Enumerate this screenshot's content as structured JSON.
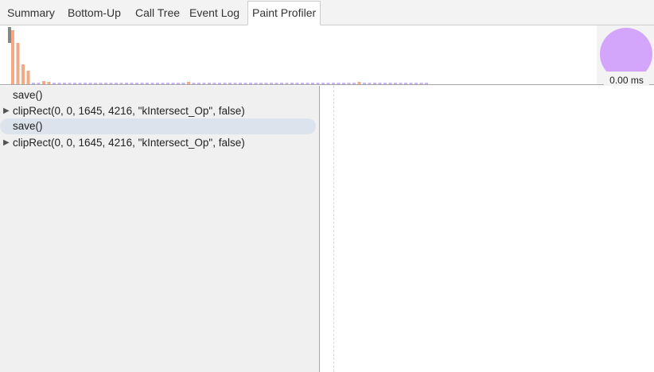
{
  "tabs": [
    {
      "label": "Summary"
    },
    {
      "label": "Bottom-Up"
    },
    {
      "label": "Call Tree"
    },
    {
      "label": "Event Log"
    },
    {
      "label": "Paint Profiler"
    }
  ],
  "selected_tab": "Paint Profiler",
  "overview": {
    "total_time": "0.00 ms",
    "bar_heights": [
      68,
      52,
      25,
      17,
      2,
      2,
      4,
      3,
      2,
      2,
      2,
      2,
      2,
      2,
      2,
      2,
      2,
      2,
      2,
      2,
      2,
      2,
      2,
      2,
      2,
      2,
      2,
      2,
      2,
      2,
      2,
      2,
      2,
      2,
      3,
      2,
      2,
      2,
      2,
      2,
      2,
      2,
      2,
      2,
      2,
      2,
      2,
      2,
      2,
      2,
      2,
      2,
      2,
      2,
      2,
      2,
      2,
      2,
      2,
      2,
      2,
      2,
      2,
      2,
      2,
      2,
      2,
      3,
      2,
      2,
      2,
      2,
      2,
      2,
      2,
      2,
      2,
      2,
      2,
      2,
      2
    ],
    "colors": {
      "raster": "#f4a984",
      "other": "#c9b4f2",
      "marker": "#888888",
      "pie": "#d4a6fb"
    }
  },
  "commands": [
    {
      "label": "save()",
      "expandable": false,
      "selected": false
    },
    {
      "label": "clipRect(0, 0, 1645, 4216, \"kIntersect_Op\", false)",
      "expandable": true,
      "selected": false
    },
    {
      "label": "save()",
      "expandable": false,
      "selected": true
    },
    {
      "label": "clipRect(0, 0, 1645, 4216, \"kIntersect_Op\", false)",
      "expandable": true,
      "selected": false
    }
  ]
}
